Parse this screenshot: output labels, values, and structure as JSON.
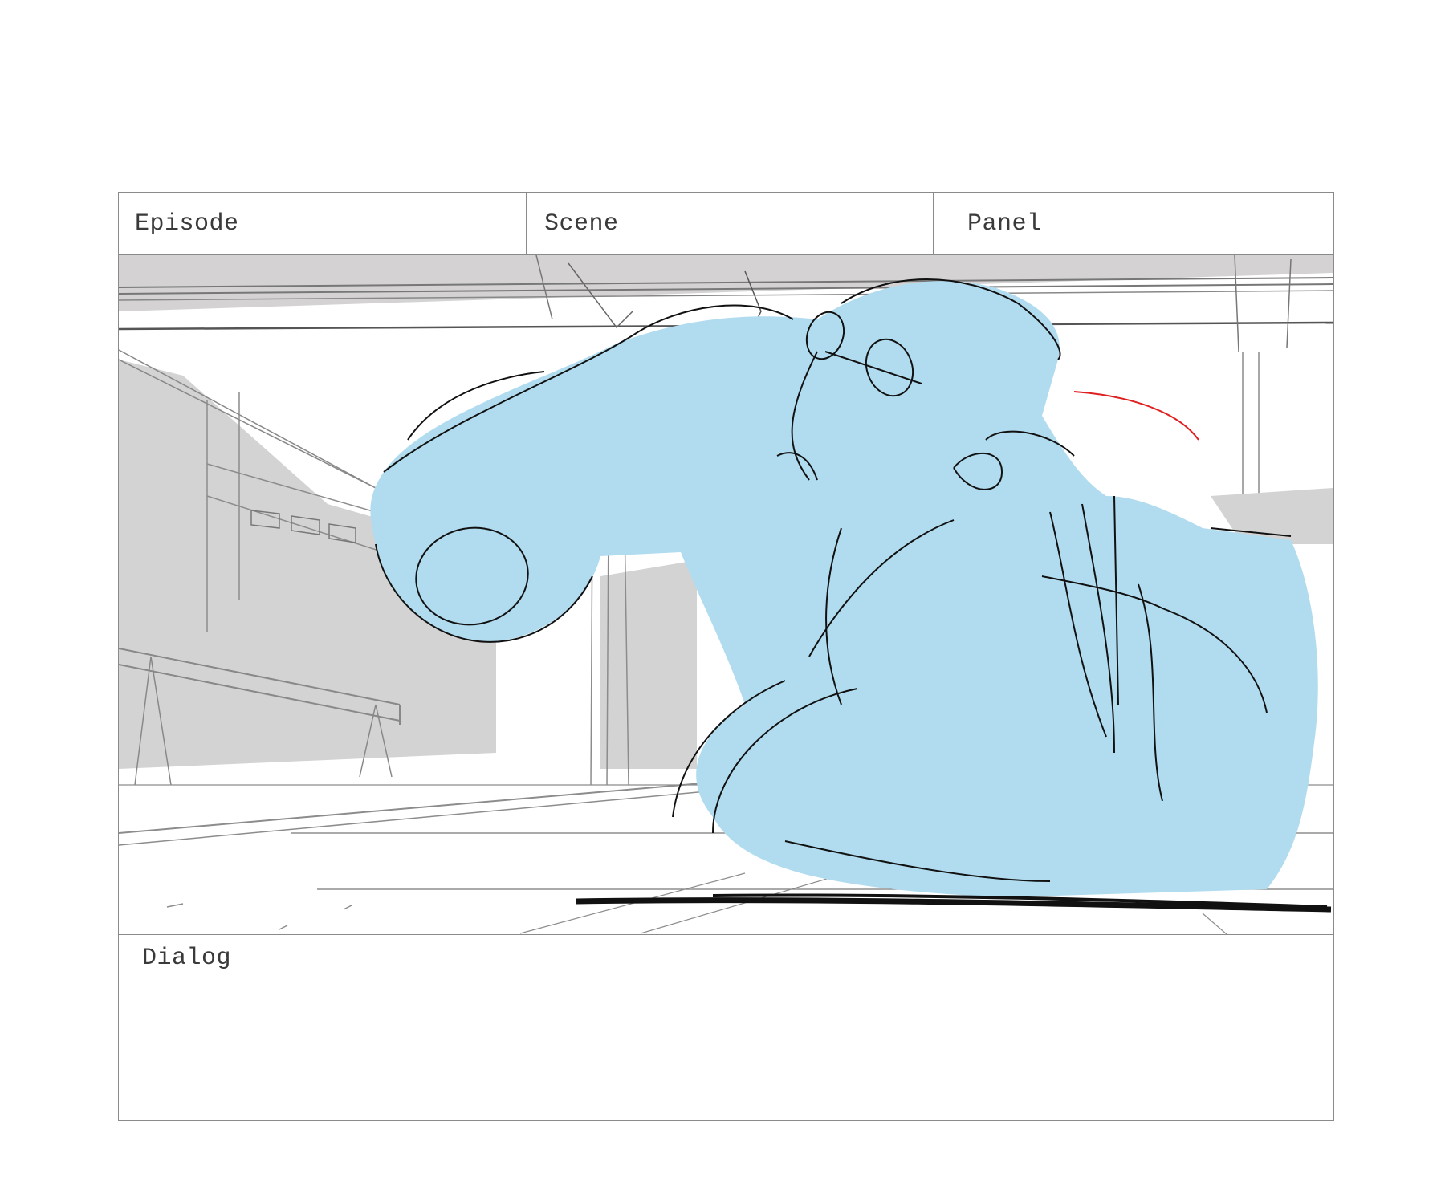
{
  "storyboard": {
    "header": {
      "episode_label": "Episode",
      "scene_label": "Scene",
      "panel_label": "Panel"
    },
    "dialog": {
      "label": "Dialog",
      "text": ""
    },
    "art": {
      "figure_fill": "#b1dcef",
      "background_fill": "#d3d3d3",
      "sketch_line": "#8c8c8c",
      "ink_line": "#111111",
      "accent_line": "#e02020"
    }
  }
}
